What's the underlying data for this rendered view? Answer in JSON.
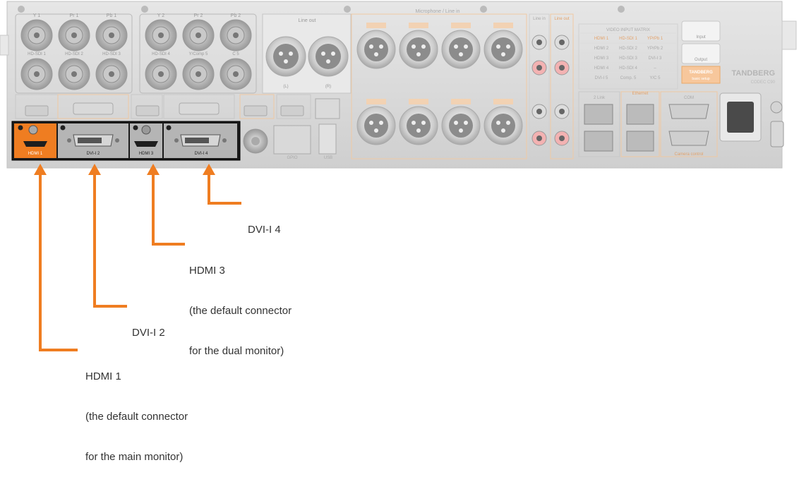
{
  "colors": {
    "accent_orange": "#ef7d21",
    "panel_gray": "#d4d4d4",
    "panel_dark": "#1a1a1a",
    "label_text": "#333333"
  },
  "panel": {
    "top_row_labels": [
      "Y 1",
      "Pr 1",
      "Pb 1",
      "Y 2",
      "Pr 2",
      "Pb 2"
    ],
    "hdsdi_labels": [
      "HD-SDI 1",
      "HD-SDI 2",
      "HD-SDI 3",
      "HD-SDI 4",
      "Y/Comp 5",
      "C 5"
    ],
    "line_out_title": "Line out",
    "line_out_sides": [
      "(L)",
      "(R)"
    ],
    "microphone_title": "Microphone / Line in",
    "line_in_title": "Line in",
    "line_out_small_title": "Line out",
    "matrix": {
      "title": "VIDEO INPUT MATRIX",
      "rows": [
        [
          "HDMI 1",
          "HD-SDI 1",
          "YPrPb 1"
        ],
        [
          "HDMI 2",
          "HD-SDI 2",
          "YPrPb 2"
        ],
        [
          "HDMI 3",
          "HD-SDI 3",
          "DVI-I 3"
        ],
        [
          "HDMI 4",
          "HD-SDI 4",
          "–"
        ],
        [
          "DVI-I 5",
          "Comp. 5",
          "Y/C 5"
        ]
      ]
    },
    "input_label": "Input",
    "output_label": "Output",
    "basic_setup_brand": "TANDBERG",
    "basic_setup_label": "basic setup",
    "brand": "TANDBERG",
    "model": "CODEC C90",
    "port_labels": [
      "HDMI 1",
      "DVI-I 2",
      "HDMI 3",
      "DVI-I 4"
    ],
    "io_labels": [
      "GPIO",
      "USB"
    ],
    "network_labels": [
      "2 Link",
      "Ethernet",
      "COM"
    ],
    "camera_control_label": "Camera control"
  },
  "callouts": {
    "dvi4": {
      "lines": [
        "DVI-I 4"
      ]
    },
    "hdmi3": {
      "lines": [
        "HDMI 3",
        "(the default connector",
        "for the dual monitor)"
      ]
    },
    "dvi2": {
      "lines": [
        "DVI-I 2"
      ]
    },
    "hdmi1": {
      "lines": [
        "HDMI 1",
        "(the default connector",
        "for the main monitor)"
      ]
    }
  }
}
